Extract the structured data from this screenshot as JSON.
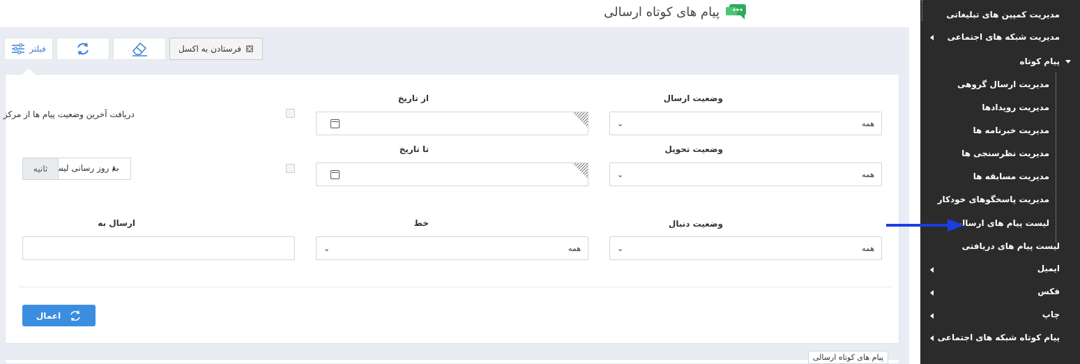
{
  "header": {
    "title": "پیام های کوتاه ارسالی",
    "icon": "chat-icon"
  },
  "toolbar": {
    "filter_label": "فیلتر",
    "excel_label": "فرستادن به اکسل"
  },
  "filters": {
    "send_status": {
      "label": "وضعیت ارسال",
      "value": "همه"
    },
    "from_date": {
      "label": "از تاریخ",
      "value": ""
    },
    "get_last_status": {
      "label": "دریافت آخرین وضعیت پیام ها از مرکز",
      "checked": false
    },
    "delivery_status": {
      "label": "وضعیت تحویل",
      "value": "همه"
    },
    "to_date": {
      "label": "تا تاریخ",
      "value": ""
    },
    "auto_refresh": {
      "label": "به روز رسانی لیست هر",
      "checked": false
    },
    "refresh_interval": {
      "value": "۶۰",
      "unit": "ثانیه"
    },
    "followup_status": {
      "label": "وضعیت دنبال",
      "value": "همه"
    },
    "line": {
      "label": "خط",
      "value": "همه"
    },
    "sent_to": {
      "label": "ارسال به",
      "value": ""
    },
    "apply_label": "اعمال"
  },
  "bottom_tab": "پیام های کوتاه ارسالی",
  "sidebar": {
    "items": [
      {
        "label": "مدیریت کمپین های تبلیغاتی",
        "level": 0
      },
      {
        "label": "مدیریت شبکه های اجتماعی",
        "level": 0
      },
      {
        "label": "پیام کوتاه",
        "level": 0,
        "expanded": true
      },
      {
        "label": "مدیریت ارسال گروهی",
        "level": 1
      },
      {
        "label": "مدیریت رویدادها",
        "level": 1
      },
      {
        "label": "مدیریت خبرنامه ها",
        "level": 1
      },
      {
        "label": "مدیریت نظرسنجی ها",
        "level": 1
      },
      {
        "label": "مدیریت مسابقه ها",
        "level": 1
      },
      {
        "label": "مدیریت پاسخگوهای خودکار",
        "level": 1
      },
      {
        "label": "لیست پیام های ارسالی",
        "level": 1,
        "active": true
      },
      {
        "label": "لیست پیام های دریافتی",
        "level": 1
      },
      {
        "label": "ایمیل",
        "level": 0
      },
      {
        "label": "فکس",
        "level": 0
      },
      {
        "label": "چاپ",
        "level": 0
      },
      {
        "label": "پیام کوتاه شبکه های اجتماعی",
        "level": 0
      }
    ]
  },
  "colors": {
    "accent": "#3b8de0",
    "sidebar_bg": "#2b2b2b",
    "arrow": "#1a3fe0",
    "brand_icon": "#2eaa5c"
  }
}
